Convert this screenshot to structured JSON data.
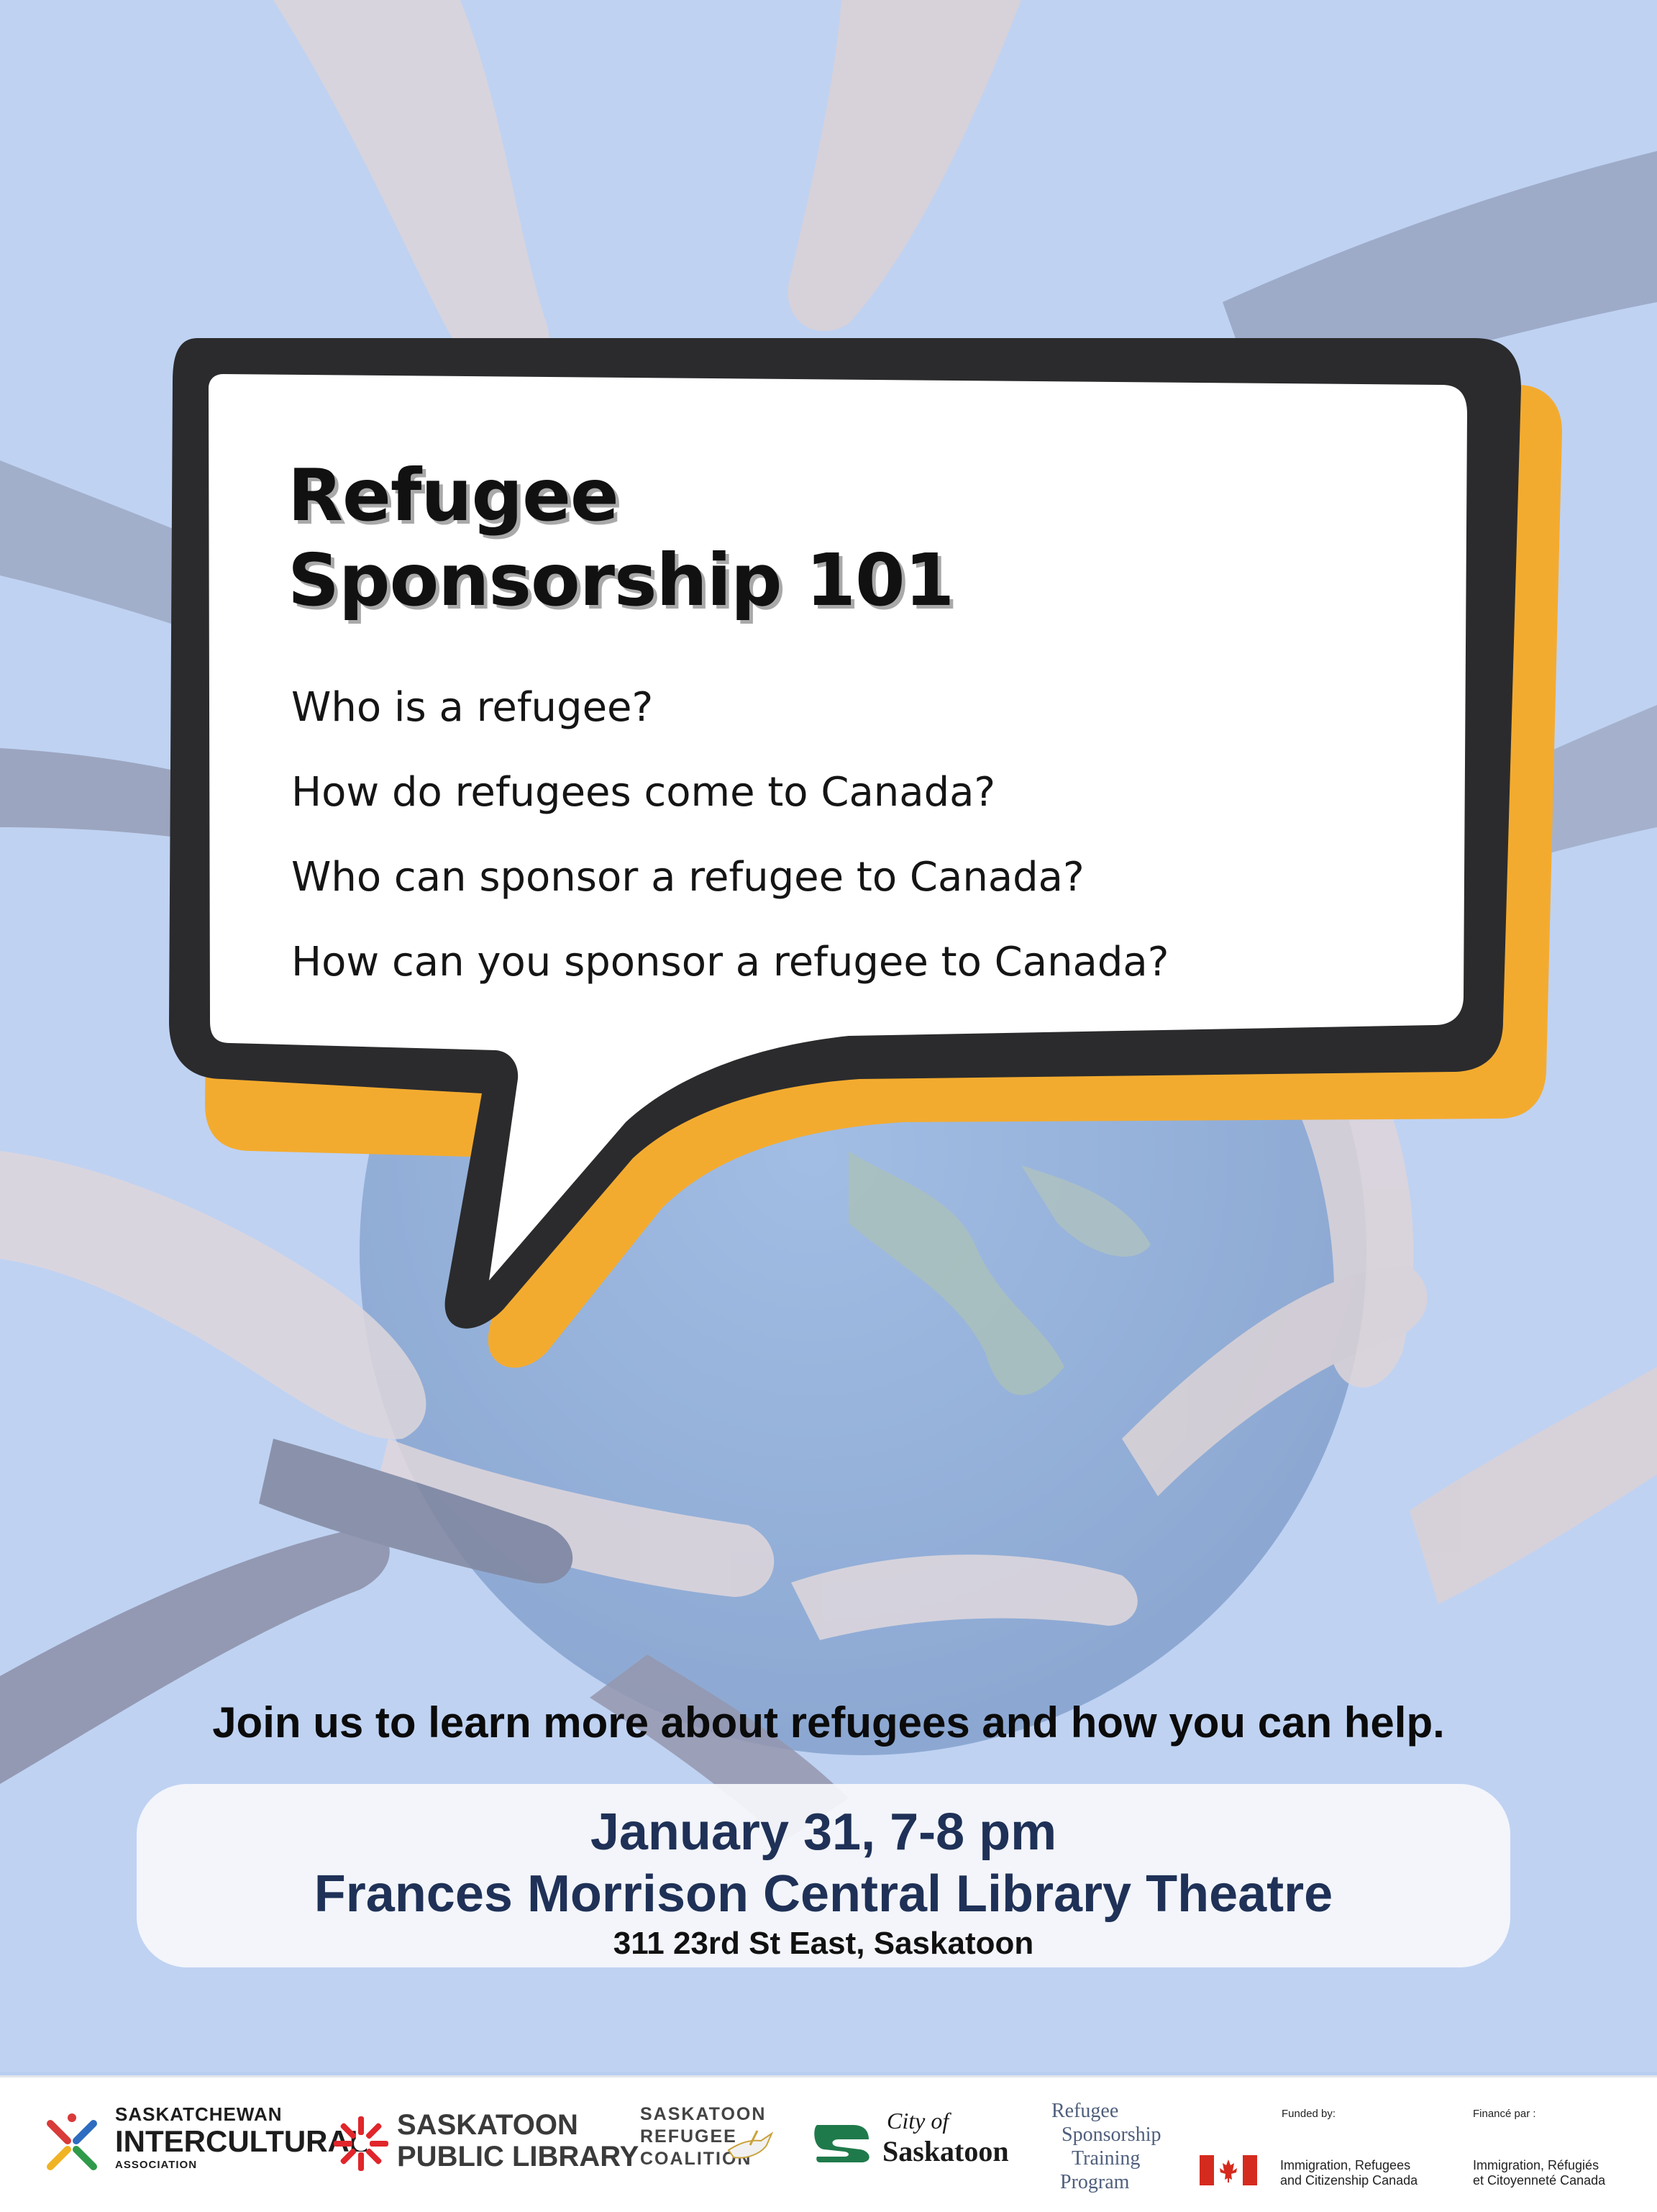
{
  "poster": {
    "title_line1": "Refugee",
    "title_line2": "Sponsorship 101",
    "questions": [
      "Who is a refugee?",
      "How do refugees come to Canada?",
      "Who can sponsor a refugee to Canada?",
      "How can you sponsor a refugee to Canada?"
    ],
    "tagline": "Join us to learn more about refugees and how you can help.",
    "event": {
      "date_time": "January 31, 7-8 pm",
      "venue": "Frances Morrison Central Library Theatre",
      "address": "311 23rd St East, Saskatoon"
    }
  },
  "colors": {
    "background": "#b9cdf0",
    "bubble_fill": "#ffffff",
    "bubble_outline": "#2b2b2d",
    "bubble_shadow": "#f3ab2f",
    "event_text": "#1f3157"
  },
  "sponsors": {
    "sia": {
      "line1": "SASKATCHEWAN",
      "line2": "INTERCULTURAL",
      "line3": "ASSOCIATION"
    },
    "spl": {
      "line1": "SASKATOON",
      "line2": "PUBLIC LIBRARY"
    },
    "src": {
      "line1": "SASKATOON",
      "line2": "REFUGEE",
      "line3": "COALITION"
    },
    "city": {
      "line1": "City of",
      "line2": "Saskatoon"
    },
    "rstp": {
      "line1": "Refugee",
      "line2": "Sponsorship",
      "line3": "Training",
      "line4": "Program"
    },
    "funded_by": "Funded by:",
    "ircc_en_line1": "Immigration, Refugees",
    "ircc_en_line2": "and Citizenship Canada",
    "finance_par": "Financé par :",
    "ircc_fr_line1": "Immigration, Réfugiés",
    "ircc_fr_line2": "et Citoyenneté Canada"
  }
}
